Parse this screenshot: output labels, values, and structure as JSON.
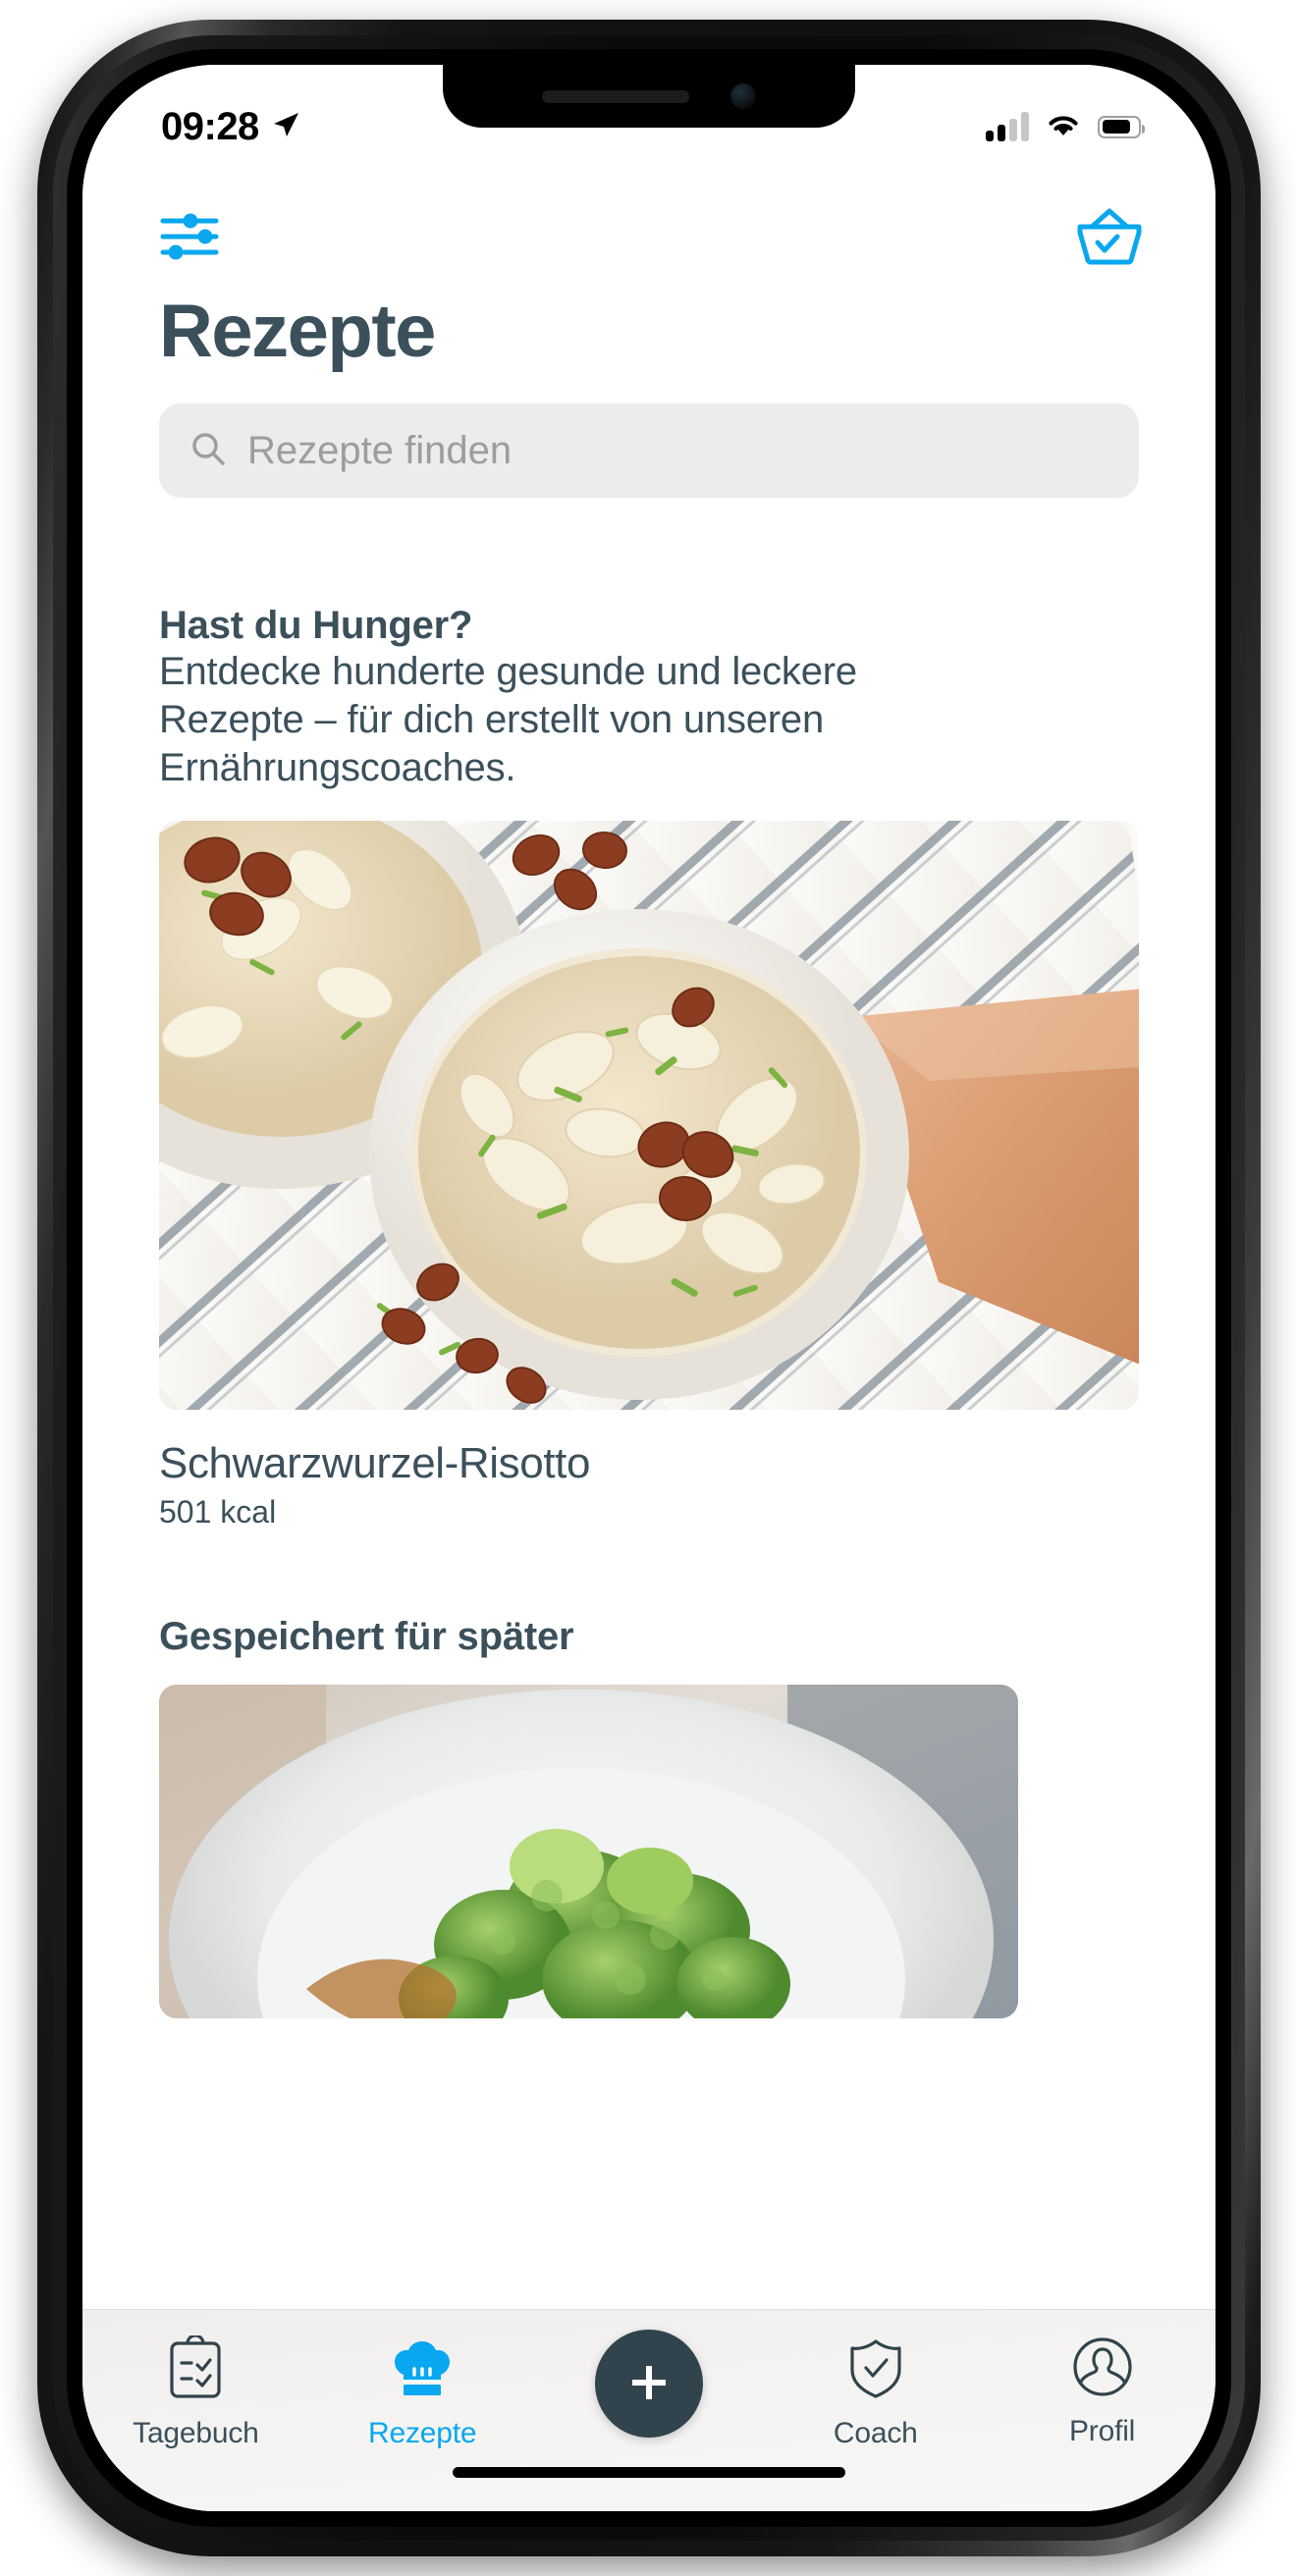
{
  "statusbar": {
    "time": "09:28",
    "location_icon": "location-arrow-icon",
    "signal_icon": "cellular-signal-icon",
    "wifi_icon": "wifi-icon",
    "battery_icon": "battery-icon",
    "battery_level_pct": 70,
    "signal_bars_filled": 2,
    "signal_bars_total": 4
  },
  "header": {
    "filter_icon": "filter-sliders-icon",
    "basket_icon": "shopping-basket-check-icon"
  },
  "page": {
    "title": "Rezepte"
  },
  "search": {
    "icon": "search-icon",
    "placeholder": "Rezepte finden",
    "value": ""
  },
  "promo": {
    "heading": "Hast du Hunger?",
    "line1": "Entdecke hunderte gesunde und leckere",
    "line2": "Rezepte – für dich erstellt von unseren",
    "line3": "Ernährungscoaches."
  },
  "featured_recipe": {
    "image_alt": "schwarzwurzel-risotto-photo",
    "name": "Schwarzwurzel-Risotto",
    "calories": "501 kcal"
  },
  "saved_section": {
    "heading": "Gespeichert für später",
    "image_alt": "broccoli-plate-photo"
  },
  "tabbar": {
    "items": [
      {
        "label": "Tagebuch",
        "icon": "clipboard-check-icon",
        "active": false
      },
      {
        "label": "Rezepte",
        "icon": "chef-hat-icon",
        "active": true
      },
      {
        "label": "Coach",
        "icon": "shield-check-icon",
        "active": false
      },
      {
        "label": "Profil",
        "icon": "person-circle-icon",
        "active": false
      }
    ],
    "fab": {
      "label": "+",
      "icon": "plus-icon"
    }
  },
  "colors": {
    "accent": "#09a7ef",
    "text_dark": "#3b505b",
    "fab_bg": "#31434c",
    "search_bg": "#ececec",
    "placeholder": "#9d9d9d"
  }
}
